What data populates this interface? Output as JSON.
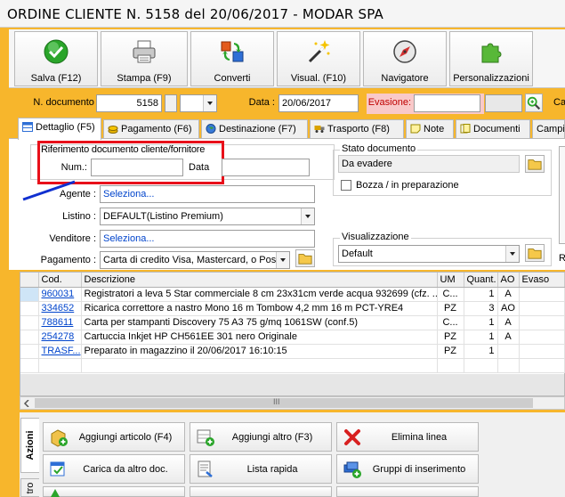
{
  "window": {
    "title": "ORDINE CLIENTE N. 5158 del 20/06/2017 - MODAR SPA"
  },
  "toolbar": {
    "buttons": [
      {
        "label": "Salva (F12)",
        "icon": "check-icon"
      },
      {
        "label": "Stampa (F9)",
        "icon": "printer-icon"
      },
      {
        "label": "Converti",
        "icon": "convert-icon"
      },
      {
        "label": "Visual. (F10)",
        "icon": "magic-wand-icon"
      },
      {
        "label": "Navigatore",
        "icon": "compass-icon"
      },
      {
        "label": "Personalizzazioni",
        "icon": "puzzle-icon"
      }
    ]
  },
  "docbar": {
    "n_documento_label": "N. documento :",
    "n_documento_value": "5158",
    "data_label": "Data :",
    "data_value": "20/06/2017",
    "evasione_label": "Evasione:",
    "evasione_value": "",
    "truncated_label": "Ca"
  },
  "tabs": [
    {
      "label": "Dettaglio (F5)",
      "icon": "table-icon",
      "active": true
    },
    {
      "label": "Pagamento (F6)",
      "icon": "coins-icon",
      "active": false
    },
    {
      "label": "Destinazione (F7)",
      "icon": "globe-icon",
      "active": false
    },
    {
      "label": "Trasporto (F8)",
      "icon": "truck-icon",
      "active": false
    },
    {
      "label": "Note",
      "icon": "note-icon",
      "active": false
    },
    {
      "label": "Documenti",
      "icon": "documents-icon",
      "active": false
    },
    {
      "label": "Campi",
      "icon": "",
      "active": false
    }
  ],
  "riferimento": {
    "title": "Riferimento documento cliente/fornitore",
    "num_label": "Num.:",
    "num_value": "",
    "data_label": "Data",
    "data_value": ""
  },
  "fields": {
    "agente_label": "Agente :",
    "agente_value": "Seleziona...",
    "listino_label": "Listino :",
    "listino_value": "DEFAULT(Listino Premium)",
    "venditore_label": "Venditore :",
    "venditore_value": "Seleziona...",
    "pagamento_label": "Pagamento :",
    "pagamento_value": "Carta di credito Visa, Mastercard, o Post"
  },
  "stato": {
    "title": "Stato documento",
    "value": "Da evadere",
    "bozza_label": "Bozza / in preparazione",
    "bozza_checked": false
  },
  "visualizzazione": {
    "title": "Visualizzazione",
    "value": "Default"
  },
  "right_stub": {
    "r_label": "R"
  },
  "grid": {
    "columns": [
      "Cod.",
      "Descrizione",
      "UM",
      "Quant.",
      "AO",
      "Evaso"
    ],
    "rows": [
      {
        "cod": "960031",
        "descrizione": "Registratori a leva 5 Star commerciale 8 cm 23x31cm verde acqua 932699 (cfz. ...",
        "um": "C...",
        "quant": "1",
        "ao": "A",
        "evaso": ""
      },
      {
        "cod": "334652",
        "descrizione": "Ricarica correttore a nastro Mono 16 m Tombow 4,2 mm 16 m PCT-YRE4",
        "um": "PZ",
        "quant": "3",
        "ao": "AO",
        "evaso": ""
      },
      {
        "cod": "788611",
        "descrizione": "Carta per stampanti Discovery 75 A3 75 g/mq 1061SW (conf.5)",
        "um": "C...",
        "quant": "1",
        "ao": "A",
        "evaso": ""
      },
      {
        "cod": "254278",
        "descrizione": "Cartuccia Inkjet HP CH561EE 301 nero Originale",
        "um": "PZ",
        "quant": "1",
        "ao": "A",
        "evaso": ""
      },
      {
        "cod": "TRASF...",
        "descrizione": "Preparato in magazzino il 20/06/2017 16:10:15",
        "um": "PZ",
        "quant": "1",
        "ao": "",
        "evaso": ""
      }
    ],
    "scroll_glyph": "III"
  },
  "side_tabs": {
    "azioni": "Azioni",
    "altro": "tro"
  },
  "actions": [
    {
      "label": "Aggiungi articolo (F4)",
      "icon": "add-item-icon"
    },
    {
      "label": "Aggiungi altro (F3)",
      "icon": "add-other-icon"
    },
    {
      "label": "Elimina linea",
      "icon": "delete-icon"
    },
    {
      "label": "Carica da altro doc.",
      "icon": "load-doc-icon"
    },
    {
      "label": "Lista rapida",
      "icon": "quick-list-icon"
    },
    {
      "label": "Gruppi di inserimento",
      "icon": "groups-icon"
    }
  ],
  "colors": {
    "frame": "#f7b62c",
    "highlight_box": "#e8101a",
    "annotation_arrow": "#1030d0",
    "link": "#0044cc",
    "evasione_bg": "#f9c9c9"
  }
}
